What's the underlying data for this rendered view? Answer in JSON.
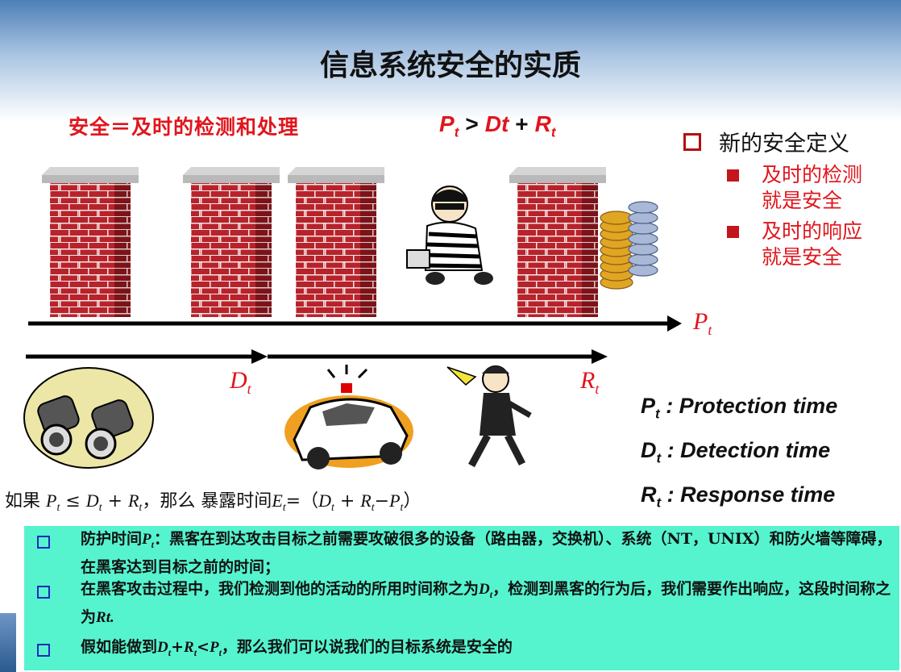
{
  "title": "信息系统安全的实质",
  "slogan": "安全＝及时的检测和处理",
  "formula": {
    "p": "P",
    "t": "t",
    "gt": ">",
    "dt": "Dt",
    "plus": "+",
    "r": "R"
  },
  "right_box": {
    "heading": "新的安全定义",
    "items": [
      {
        "line1": "及时的检测",
        "line2": "就是安全"
      },
      {
        "line1": "及时的响应",
        "line2": "就是安全"
      }
    ]
  },
  "timeline": {
    "p_label": "P",
    "d_label": "D",
    "r_label": "R",
    "sub": "t"
  },
  "definitions": [
    {
      "sym": "P",
      "sub": "t",
      "text": " : Protection time"
    },
    {
      "sym": "D",
      "sub": "t",
      "text": " : Detection time"
    },
    {
      "sym": "R",
      "sub": "t",
      "text": " : Response time"
    }
  ],
  "exposure": {
    "prefix": "如果 ",
    "cond": "P",
    "le": " ≤ ",
    "d": "D",
    "plus": " + ",
    "r": "R",
    "mid": "，那么 暴露时间",
    "e": "E",
    "rest_a": "=（",
    "rest_b": "−",
    "rest_c": "）"
  },
  "bullets": [
    {
      "a": "防护时间",
      "b": "P",
      "c": "：黑客在到达攻击目标之前需要攻破很多的设备（路由器，交换机）、系统（NT，UNIX）和防火墙等障碍，在黑客达到目标之前的时间；"
    },
    {
      "a": "在黑客攻击过程中，我们检测到他的活动的所用时间称之为",
      "b": "D",
      "c": "，检测到黑客的行为后，我们需要作出响应，这段时间称之为",
      "d": "Rt."
    },
    {
      "a": "假如能做到",
      "b": "D",
      "c": "+",
      "d": "R",
      "e": "<",
      "f": "P",
      "g": "，那么我们可以说我们的目标系统是安全的"
    }
  ],
  "colors": {
    "accent_red": "#e0151c",
    "bottom_box": "#55f4cf",
    "brick": "#b8232b",
    "title": "#111111"
  }
}
